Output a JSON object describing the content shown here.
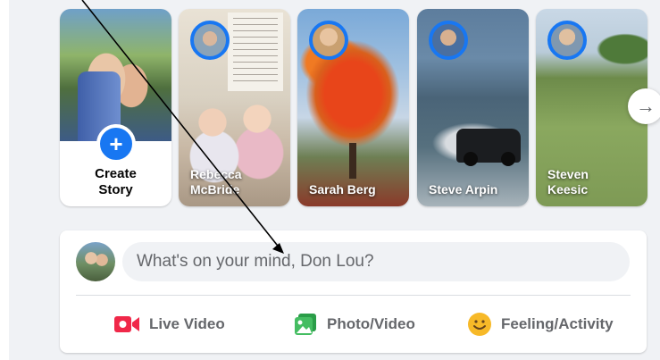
{
  "stories": {
    "create": {
      "label_line1": "Create",
      "label_line2": "Story"
    },
    "items": [
      {
        "name": "Rebecca\nMcBride"
      },
      {
        "name": "Sarah Berg"
      },
      {
        "name": "Steve Arpin"
      },
      {
        "name": "Steven\nKeesic"
      }
    ],
    "next_arrow": "→"
  },
  "composer": {
    "placeholder": "What's on your mind, Don Lou?",
    "actions": {
      "live": "Live Video",
      "photo": "Photo/Video",
      "feeling": "Feeling/Activity"
    }
  },
  "colors": {
    "accent": "#1877f2",
    "live_red": "#f02849",
    "photo_green": "#45bd62",
    "feeling_yellow": "#f7b928"
  },
  "icons": [
    "plus-icon",
    "arrow-right-icon",
    "video-camera-icon",
    "photo-icon",
    "smiley-icon"
  ]
}
